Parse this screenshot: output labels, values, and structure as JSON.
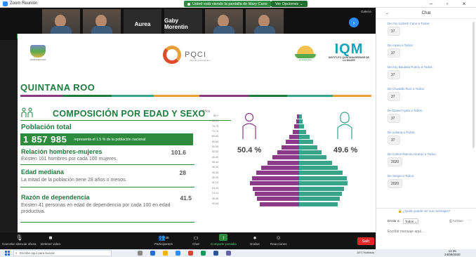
{
  "window": {
    "title": "Zoom Reunión",
    "share_banner": "Usted está viendo la pantalla de Mary Cano",
    "view_options": "Ver Opciones"
  },
  "gallery": {
    "tiles": [
      {
        "name": "Yesli He",
        "type": "video"
      },
      {
        "name": "Nidia Kuri",
        "type": "video"
      },
      {
        "name": "Aurea",
        "type": "name"
      },
      {
        "name": "Gaby Morentin",
        "type": "name"
      },
      {
        "name": "José Manuel C.",
        "type": "video"
      },
      {
        "name": "Itzel L.",
        "type": "video"
      }
    ],
    "view_label": "Galería"
  },
  "slide": {
    "logo_left_text": "QUINTANA ROO",
    "pqci": "PQCI",
    "pqci_sub": "Plan de Quintana Roo",
    "green_logo_text": "Quintana Roo",
    "iqm": "IQM",
    "iqm_sub": "INSTITUTO QUINTANARRENSE DE LA MUJER",
    "state": "QUINTANA ROO",
    "color_bar": [
      "#8a3a87",
      "#1e7a3d",
      "#3aa48a",
      "#e8a03a",
      "#8a3a87",
      "#1e7a3d",
      "#3aa48a",
      "#e8a03a"
    ],
    "section_title": "COMPOSICIÓN POR EDAD Y SEXO",
    "population_label": "Población total",
    "population_value": "1 857 985",
    "population_note": "representa el 1.5 % de la población nacional",
    "items": [
      {
        "label": "Relación hombres-mujeres",
        "value": "101.6",
        "desc": "Existen 101 hombres por cada 100 mujeres."
      },
      {
        "label": "Edad mediana",
        "value": "28",
        "desc": "La mitad de la población tiene 28 años o menos."
      },
      {
        "label": "Razón de dependencia",
        "value": "41.5",
        "desc": "Existen 41 personas en edad de dependencia por cada 100 en edad productiva."
      }
    ],
    "pyramid": {
      "axis_title": "Años",
      "age_groups": [
        "85 +",
        "80-84",
        "75-79",
        "70-74",
        "65-69",
        "60-64",
        "55-59",
        "50-54",
        "45-49",
        "40-44",
        "35-39",
        "30-34",
        "25-29",
        "20-24",
        "15-19",
        "10-14",
        "05-09",
        "00-04"
      ],
      "male_pct": "50.4 %",
      "female_pct": "49.6 %",
      "male_values": [
        0.4,
        0.6,
        0.9,
        1.3,
        1.9,
        2.6,
        3.4,
        4.3,
        5.2,
        6.2,
        7.4,
        8.4,
        9.2,
        9.6,
        9.0,
        8.6,
        8.2,
        7.7
      ],
      "female_values": [
        0.5,
        0.7,
        1.0,
        1.4,
        2.0,
        2.7,
        3.5,
        4.4,
        5.4,
        6.4,
        7.6,
        8.5,
        9.3,
        9.5,
        8.8,
        8.4,
        8.0,
        7.5
      ],
      "male_color": "#8a3a87",
      "female_color": "#3aa48a"
    }
  },
  "toolbar": {
    "items": [
      {
        "label": "Cancelar silenciar ahora",
        "icon": "mic-icon"
      },
      {
        "label": "Detener video",
        "icon": "video-icon"
      },
      {
        "label": "Participantes",
        "icon": "participants-icon",
        "count": "48"
      },
      {
        "label": "Chat",
        "icon": "chat-icon"
      },
      {
        "label": "Compartir pantalla",
        "icon": "share-screen-icon"
      },
      {
        "label": "Grabar",
        "icon": "record-icon"
      },
      {
        "label": "Reacciones",
        "icon": "reactions-icon"
      }
    ],
    "leave": "Salir"
  },
  "chat": {
    "title": "Chat",
    "messages": [
      {
        "from": "De Any Lisbeth Cano a Todos:",
        "text": "37"
      },
      {
        "from": "De Aurea a Todos:",
        "text": "37"
      },
      {
        "from": "De Any Bautista Puerto a Todos:",
        "text": "37"
      },
      {
        "from": "De Oswaldo Ruiz a Todos:",
        "text": "37"
      },
      {
        "from": "De Daniel Ayala a Todos:",
        "text": "37"
      },
      {
        "from": "De yuliana a Todos:",
        "text": "37"
      },
      {
        "from": "De Carlos Ramos Alcaraz a Todos:",
        "text": "2020"
      },
      {
        "from": "De Sergio a Todos:",
        "text": "2020"
      }
    ],
    "dm_prompt": "¿Quién puede ver sus mensajes?",
    "to_label": "Enviar a:",
    "to_value": "Todos",
    "file_label": "Archivo",
    "input_placeholder": "Escribir mensaje aquí..."
  },
  "taskbar": {
    "search_placeholder": "Escribe aquí para buscar",
    "tray": "18°C  Nublado",
    "time": "11:25",
    "date": "24/09/2020"
  }
}
